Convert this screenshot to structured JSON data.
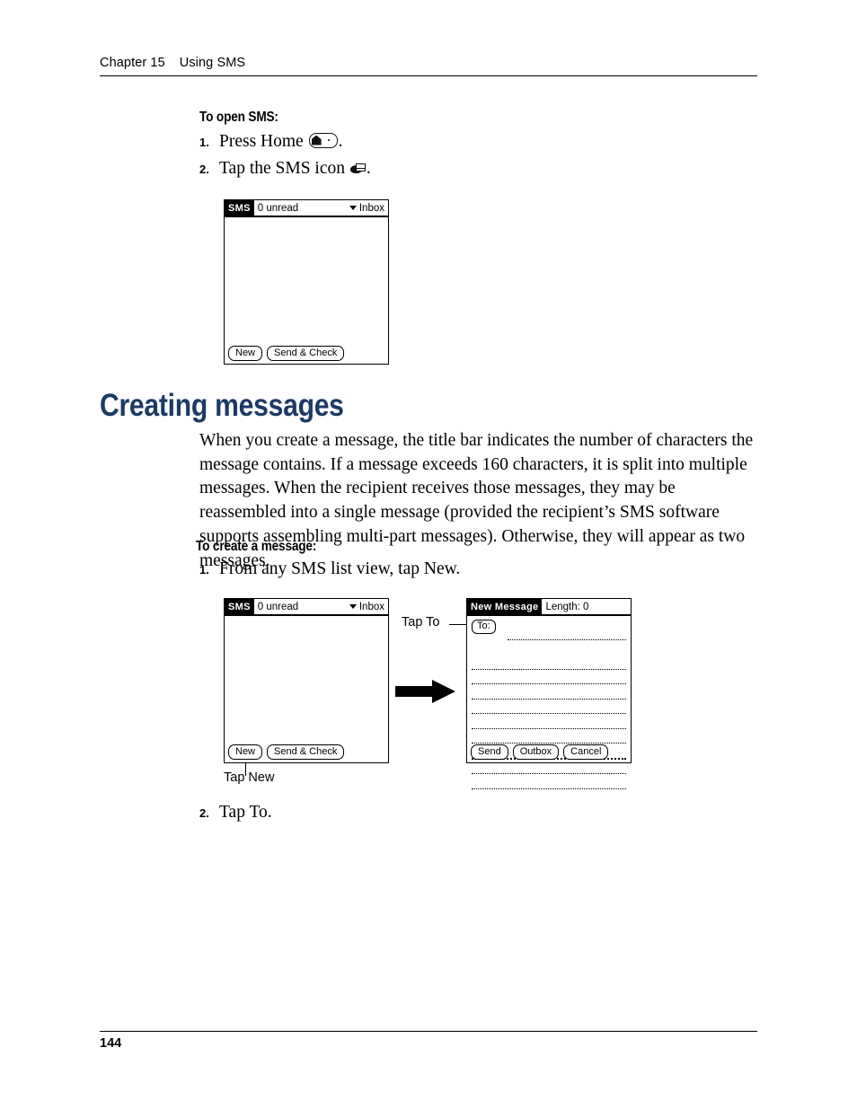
{
  "header": {
    "chapter": "Chapter 15",
    "title": "Using SMS"
  },
  "sections": {
    "open_sms": {
      "heading": "To open SMS:",
      "steps": [
        {
          "num": "1.",
          "text_before": "Press Home ",
          "icon": "home-icon",
          "text_after": "."
        },
        {
          "num": "2.",
          "text_before": "Tap the SMS icon ",
          "icon": "sms-icon",
          "text_after": "."
        }
      ]
    },
    "creating": {
      "title": "Creating messages",
      "paragraph": "When you create a message, the title bar indicates the number of characters the message contains. If a message exceeds 160 characters, it is split into multiple messages. When the recipient receives those messages, they may be reassembled into a single message (provided the recipient’s SMS software supports assembling multi-part messages). Otherwise, they will appear as two messages.",
      "heading": "To create a message:",
      "step1": {
        "num": "1.",
        "text": "From any SMS list view, tap New."
      },
      "step2": {
        "num": "2.",
        "text": "Tap To."
      }
    }
  },
  "figure_one": {
    "screen": {
      "app_tab": "SMS",
      "status": "0 unread",
      "dropdown": "Inbox",
      "buttons": [
        "New",
        "Send & Check"
      ]
    }
  },
  "figure_two": {
    "left_screen": {
      "app_tab": "SMS",
      "status": "0 unread",
      "dropdown": "Inbox",
      "buttons": [
        "New",
        "Send & Check"
      ]
    },
    "right_screen": {
      "app_tab": "New Message",
      "status": "Length: 0",
      "to_button": "To:",
      "buttons": [
        "Send",
        "Outbox",
        "Cancel"
      ],
      "ruled_line_count": 11
    },
    "callouts": {
      "tap_to": "Tap To",
      "tap_new": "Tap New"
    }
  },
  "footer": {
    "page_number": "144"
  },
  "colors": {
    "heading_navy": "#1b3a66",
    "text_black": "#000000",
    "page_background": "#ffffff"
  }
}
